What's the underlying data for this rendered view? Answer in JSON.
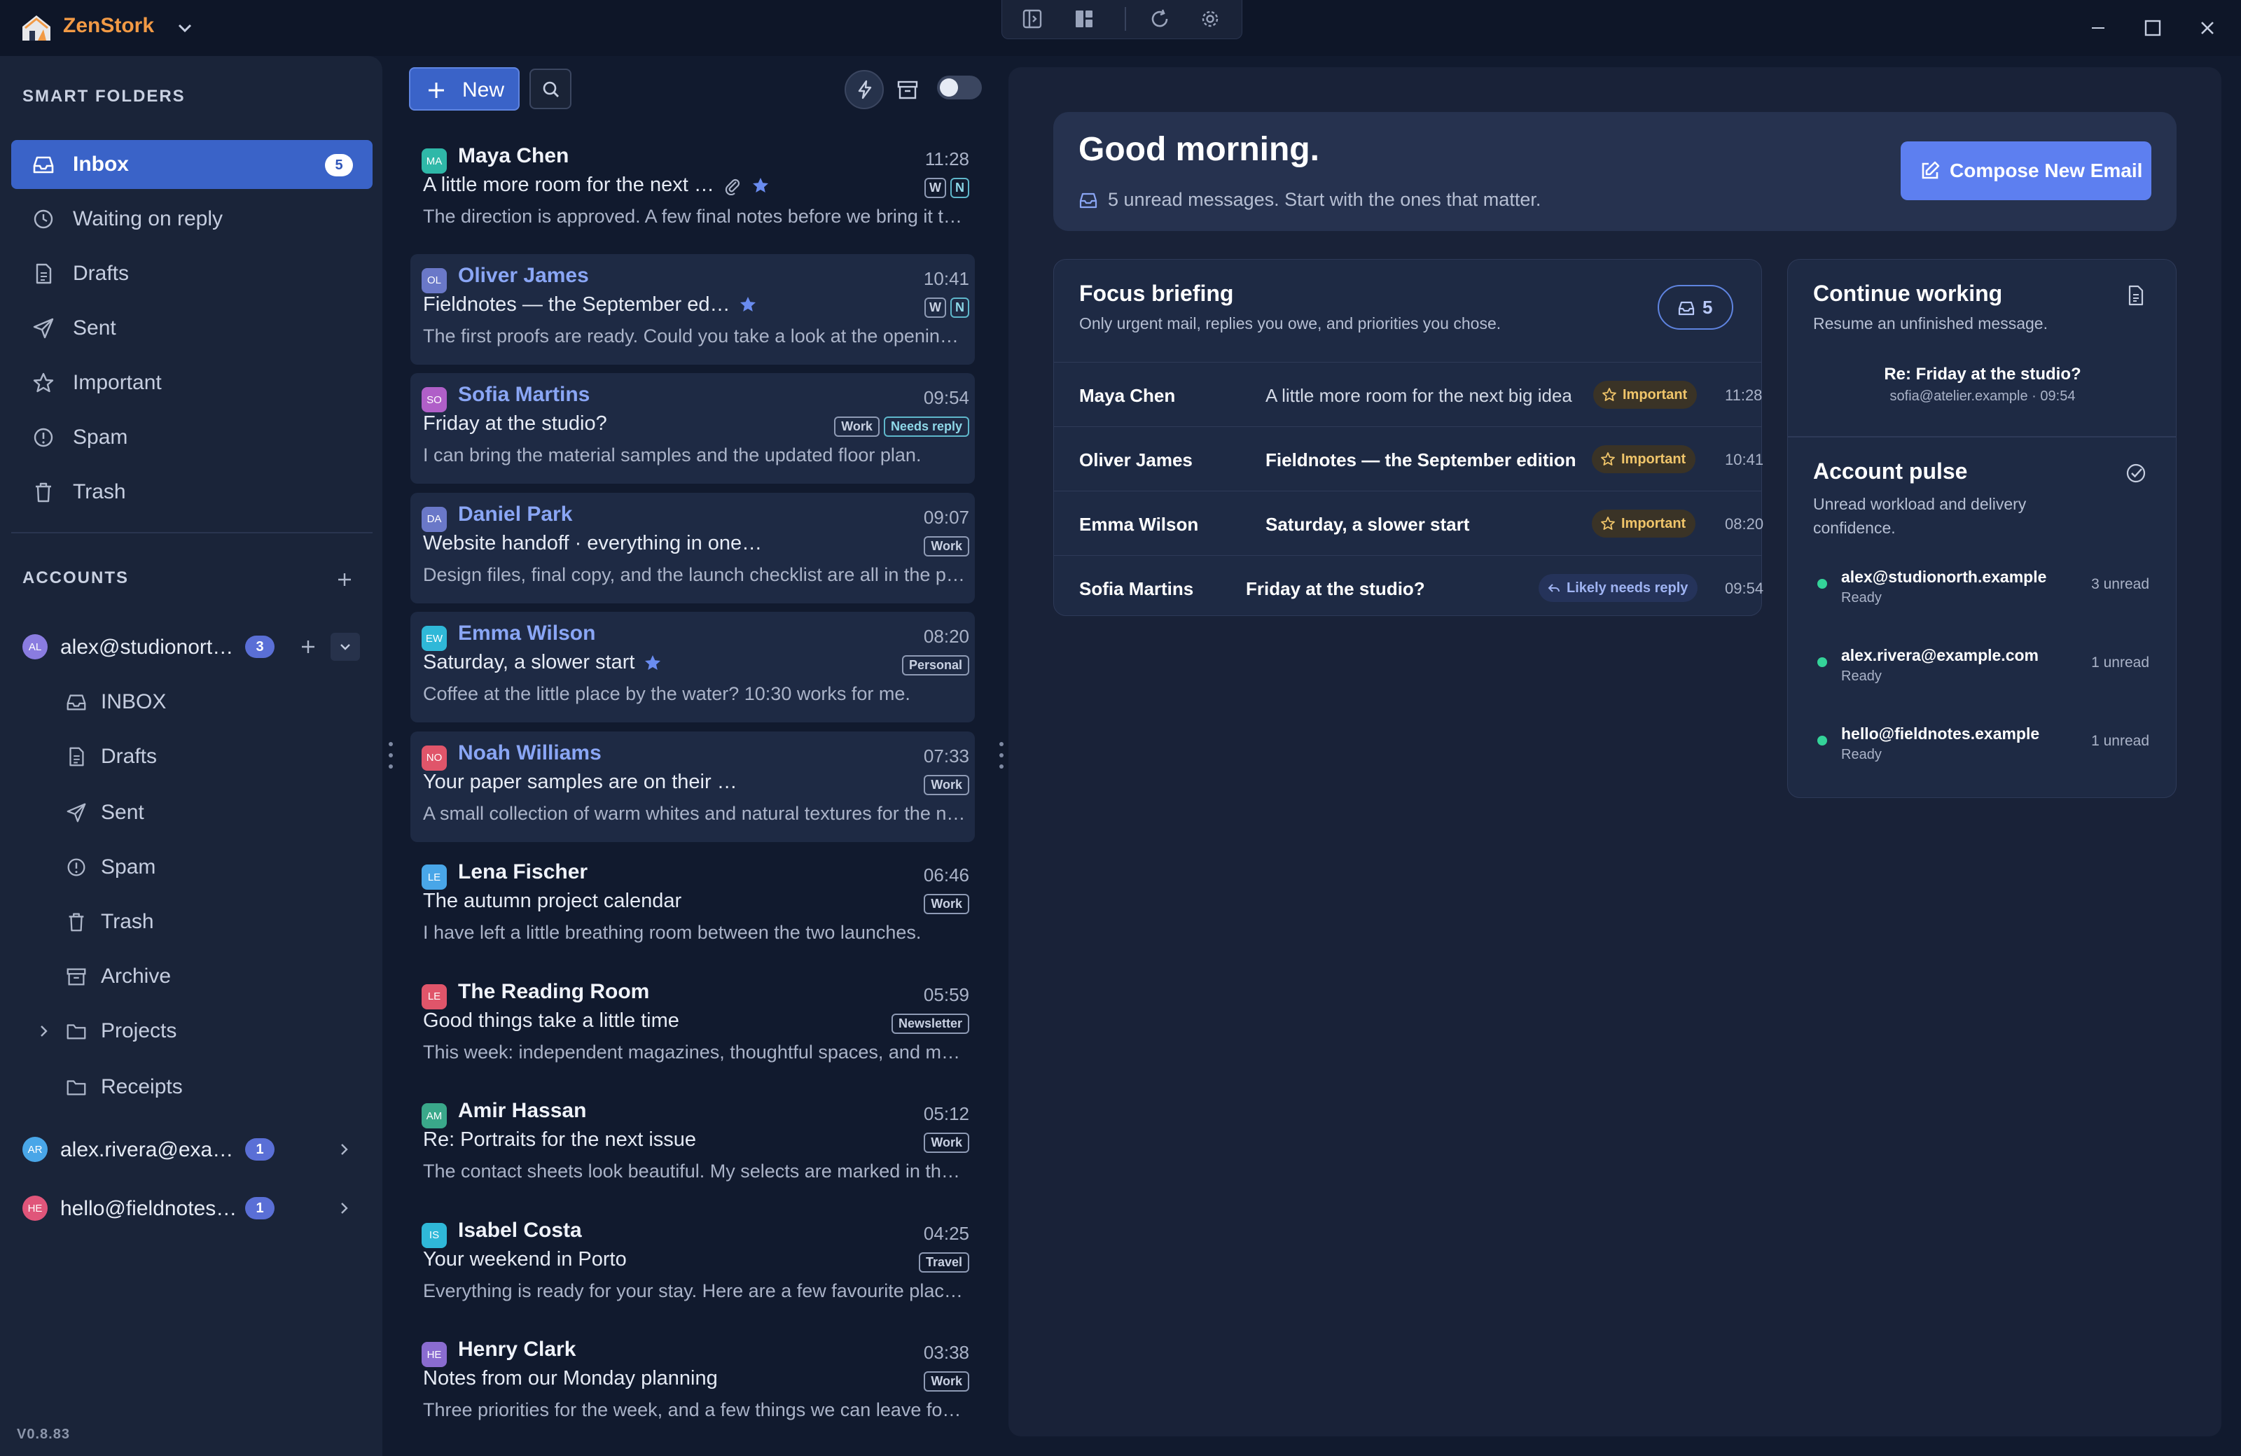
{
  "app": {
    "name": "ZenStork",
    "version": "V0.8.83"
  },
  "sidebar": {
    "smart_folders_heading": "SMART FOLDERS",
    "smart_folders": [
      {
        "label": "Inbox",
        "count": "5",
        "icon": "inbox-icon",
        "active": true
      },
      {
        "label": "Waiting on reply",
        "icon": "clock-icon"
      },
      {
        "label": "Drafts",
        "icon": "file-icon"
      },
      {
        "label": "Sent",
        "icon": "send-icon"
      },
      {
        "label": "Important",
        "icon": "star-icon"
      },
      {
        "label": "Spam",
        "icon": "alert-circle-icon"
      },
      {
        "label": "Trash",
        "icon": "trash-icon"
      }
    ],
    "accounts_heading": "ACCOUNTS",
    "accounts": [
      {
        "initials": "AL",
        "email": "alex@studionorth.example",
        "count": "3",
        "color": "#8a7ce0"
      },
      {
        "initials": "AR",
        "email": "alex.rivera@example.com",
        "count": "1",
        "color": "#49a6e8"
      },
      {
        "initials": "HE",
        "email": "hello@fieldnotes.example",
        "count": "1",
        "color": "#e0557a"
      }
    ],
    "account_folders": [
      {
        "label": "INBOX",
        "icon": "inbox-icon"
      },
      {
        "label": "Drafts",
        "icon": "file-icon"
      },
      {
        "label": "Sent",
        "icon": "send-icon"
      },
      {
        "label": "Spam",
        "icon": "alert-circle-icon"
      },
      {
        "label": "Trash",
        "icon": "trash-icon"
      },
      {
        "label": "Archive",
        "icon": "archive-icon"
      },
      {
        "label": "Projects",
        "icon": "folder-icon"
      },
      {
        "label": "Receipts",
        "icon": "folder-icon"
      }
    ]
  },
  "toolbar": {
    "new_label": "New"
  },
  "messages": [
    {
      "initials": "MA",
      "color": "#2fb8a8",
      "from": "Maya Chen",
      "time": "11:28",
      "subject": "A little more room for the next …",
      "preview": "The direction is approved. A few final notes before we bring it t…",
      "unread": false,
      "attach": true,
      "star": true,
      "tags": [
        "W",
        "N"
      ]
    },
    {
      "initials": "OL",
      "color": "#6a78c8",
      "from": "Oliver James",
      "time": "10:41",
      "subject": "Fieldnotes — the September ed…",
      "preview": "The first proofs are ready. Could you take a look at the openin…",
      "unread": true,
      "star": true,
      "tags": [
        "W",
        "N"
      ]
    },
    {
      "initials": "SO",
      "color": "#b05fc8",
      "from": "Sofia Martins",
      "time": "09:54",
      "subject": "Friday at the studio?",
      "preview": "I can bring the material samples and the updated floor plan.",
      "unread": true,
      "tags": [
        "Work",
        "Needs reply"
      ]
    },
    {
      "initials": "DA",
      "color": "#6a78c8",
      "from": "Daniel Park",
      "time": "09:07",
      "subject": "Website handoff · everything in one…",
      "preview": "Design files, final copy, and the launch checklist are all in the p…",
      "unread": true,
      "tags": [
        "Work"
      ]
    },
    {
      "initials": "EW",
      "color": "#2fb8d8",
      "from": "Emma Wilson",
      "time": "08:20",
      "subject": "Saturday, a slower start",
      "preview": "Coffee at the little place by the water? 10:30 works for me.",
      "unread": true,
      "star": true,
      "tags": [
        "Personal"
      ]
    },
    {
      "initials": "NO",
      "color": "#e0556a",
      "from": "Noah Williams",
      "time": "07:33",
      "subject": "Your paper samples are on their …",
      "preview": "A small collection of warm whites and natural textures for the n…",
      "unread": true,
      "tags": [
        "Work"
      ]
    },
    {
      "initials": "LE",
      "color": "#49a6e8",
      "from": "Lena Fischer",
      "time": "06:46",
      "subject": "The autumn project calendar",
      "preview": "I have left a little breathing room between the two launches.",
      "unread": false,
      "tags": [
        "Work"
      ]
    },
    {
      "initials": "LE",
      "color": "#e0556a",
      "from": "The Reading Room",
      "time": "05:59",
      "subject": "Good things take a little time",
      "preview": "This week: independent magazines, thoughtful spaces, and m…",
      "unread": false,
      "tags": [
        "Newsletter"
      ]
    },
    {
      "initials": "AM",
      "color": "#3aa88a",
      "from": "Amir Hassan",
      "time": "05:12",
      "subject": "Re: Portraits for the next issue",
      "preview": "The contact sheets look beautiful. My selects are marked in th…",
      "unread": false,
      "tags": [
        "Work"
      ]
    },
    {
      "initials": "IS",
      "color": "#2fb8d8",
      "from": "Isabel Costa",
      "time": "04:25",
      "subject": "Your weekend in Porto",
      "preview": "Everything is ready for your stay. Here are a few favourite plac…",
      "unread": false,
      "tags": [
        "Travel"
      ]
    },
    {
      "initials": "HE",
      "color": "#8a6cd0",
      "from": "Henry Clark",
      "time": "03:38",
      "subject": "Notes from our Monday planning",
      "preview": "Three priorities for the week, and a few things we can leave fo…",
      "unread": false,
      "tags": [
        "Work"
      ]
    }
  ],
  "hero": {
    "greeting": "Good morning.",
    "summary": "5 unread messages. Start with the ones that matter.",
    "compose_label": "Compose New Email"
  },
  "focus": {
    "title": "Focus briefing",
    "subtitle": "Only urgent mail, replies you owe, and priorities you chose.",
    "count": "5",
    "rows": [
      {
        "name": "Maya Chen",
        "subject": "A little more room for the next big idea",
        "pill": "Important",
        "time": "11:28",
        "bold": false
      },
      {
        "name": "Oliver James",
        "subject": "Fieldnotes — the September edition",
        "pill": "Important",
        "time": "10:41",
        "bold": true
      },
      {
        "name": "Emma Wilson",
        "subject": "Saturday, a slower start",
        "pill": "Important",
        "time": "08:20",
        "bold": true
      },
      {
        "name": "Sofia Martins",
        "subject": "Friday at the studio?",
        "pill": "Likely needs reply",
        "time": "09:54",
        "bold": true
      }
    ]
  },
  "continue": {
    "title": "Continue working",
    "subtitle": "Resume an unfinished message.",
    "draft_subject": "Re: Friday at the studio?",
    "draft_meta": "sofia@atelier.example · 09:54"
  },
  "pulse": {
    "title": "Account pulse",
    "subtitle": "Unread workload and delivery confidence.",
    "accounts": [
      {
        "email": "alex@studionorth.example",
        "status": "Ready",
        "unread": "3 unread"
      },
      {
        "email": "alex.rivera@example.com",
        "status": "Ready",
        "unread": "1 unread"
      },
      {
        "email": "hello@fieldnotes.example",
        "status": "Ready",
        "unread": "1 unread"
      }
    ]
  }
}
